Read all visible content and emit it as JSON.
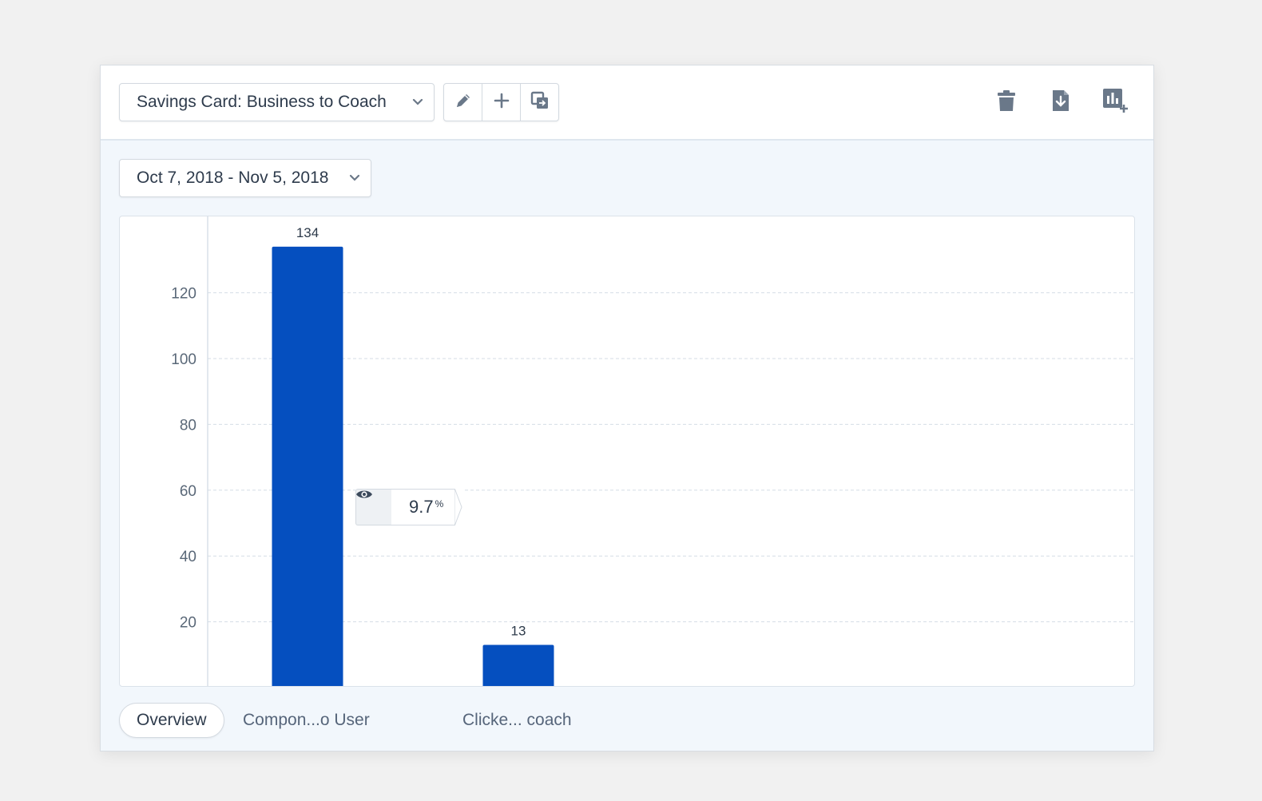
{
  "header": {
    "report_select": {
      "value": "Savings Card: Business to Coach",
      "icon": "chevron-down-icon"
    },
    "toolbar": [
      {
        "name": "edit",
        "icon": "pencil-icon"
      },
      {
        "name": "add",
        "icon": "plus-icon"
      },
      {
        "name": "duplicate",
        "icon": "copy-icon"
      }
    ],
    "actions": [
      {
        "name": "delete",
        "icon": "trash-icon"
      },
      {
        "name": "export",
        "icon": "download-file-icon"
      },
      {
        "name": "add-to-dashboard",
        "icon": "chart-plus-icon"
      }
    ]
  },
  "date_range": {
    "value": "Oct 7, 2018 - Nov 5, 2018",
    "icon": "chevron-down-icon"
  },
  "conversion": {
    "value": "9.7",
    "unit": "%",
    "icon": "eye-icon"
  },
  "tabs": [
    {
      "label": "Overview",
      "active": true
    },
    {
      "label": "Compon...o User",
      "active": false
    },
    {
      "label": "Clicke... coach",
      "active": false
    }
  ],
  "colors": {
    "bar": "#054fbf",
    "grid": "#d5dde6",
    "background": "#f2f7fc"
  },
  "chart_data": {
    "type": "bar",
    "categories": [
      "Compon...o User",
      "Clicke... coach"
    ],
    "values": [
      134,
      13
    ],
    "ylim": [
      0,
      140
    ],
    "yticks": [
      20,
      40,
      60,
      80,
      100,
      120
    ],
    "grid": true
  }
}
